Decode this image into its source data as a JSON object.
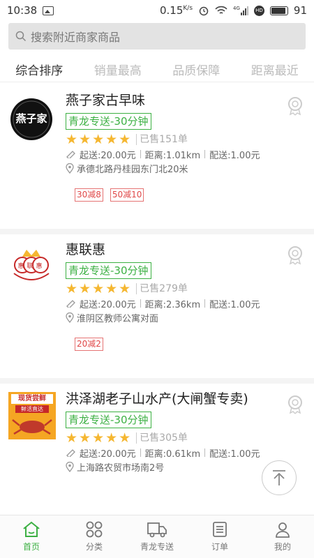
{
  "status_bar": {
    "time": "10:38",
    "speed": "0.15",
    "speed_unit": "K/s",
    "signal_type": "4G",
    "hd": "HD",
    "battery": "91",
    "battery_fraction": 0.9
  },
  "search": {
    "placeholder": "搜索附近商家商品"
  },
  "sort_tabs": [
    {
      "label": "综合排序",
      "active": true
    },
    {
      "label": "销量最高",
      "active": false
    },
    {
      "label": "品质保障",
      "active": false
    },
    {
      "label": "距离最近",
      "active": false
    }
  ],
  "stores": [
    {
      "name": "燕子家古早味",
      "delivery_badge": "青龙专送-30分钟",
      "rating": 5,
      "sold": "已售151单",
      "min_order": "起送:20.00元",
      "distance": "距离:1.01km",
      "delivery_fee": "配送:1.00元",
      "address": "承德北路丹桂园东门北20米",
      "promos": [
        "30减8",
        "50减10"
      ],
      "logo_text": "燕子家"
    },
    {
      "name": "惠联惠",
      "delivery_badge": "青龙专送-30分钟",
      "rating": 5,
      "sold": "已售279单",
      "min_order": "起送:20.00元",
      "distance": "距离:2.36km",
      "delivery_fee": "配送:1.00元",
      "address": "淮阴区教师公寓对面",
      "promos": [
        "20减2"
      ],
      "logo_text": "惠联惠"
    },
    {
      "name": "洪泽湖老子山水产(大闸蟹专卖)",
      "delivery_badge": "青龙专送-30分钟",
      "rating": 5,
      "sold": "已售305单",
      "min_order": "起送:20.00元",
      "distance": "距离:0.61km",
      "delivery_fee": "配送:1.00元",
      "address": "上海路农贸市场南2号",
      "promos": [],
      "logo_text_top": "现货尝鲜",
      "logo_text_sub": "鲜活直达"
    }
  ],
  "tabbar": [
    {
      "label": "首页",
      "icon": "home-icon",
      "active": true
    },
    {
      "label": "分类",
      "icon": "category-icon",
      "active": false
    },
    {
      "label": "青龙专送",
      "icon": "delivery-truck-icon",
      "active": false
    },
    {
      "label": "订单",
      "icon": "order-list-icon",
      "active": false
    },
    {
      "label": "我的",
      "icon": "profile-icon",
      "active": false
    }
  ],
  "colors": {
    "accent": "#3cb043",
    "star": "#f5b731",
    "promo": "#e04848"
  }
}
